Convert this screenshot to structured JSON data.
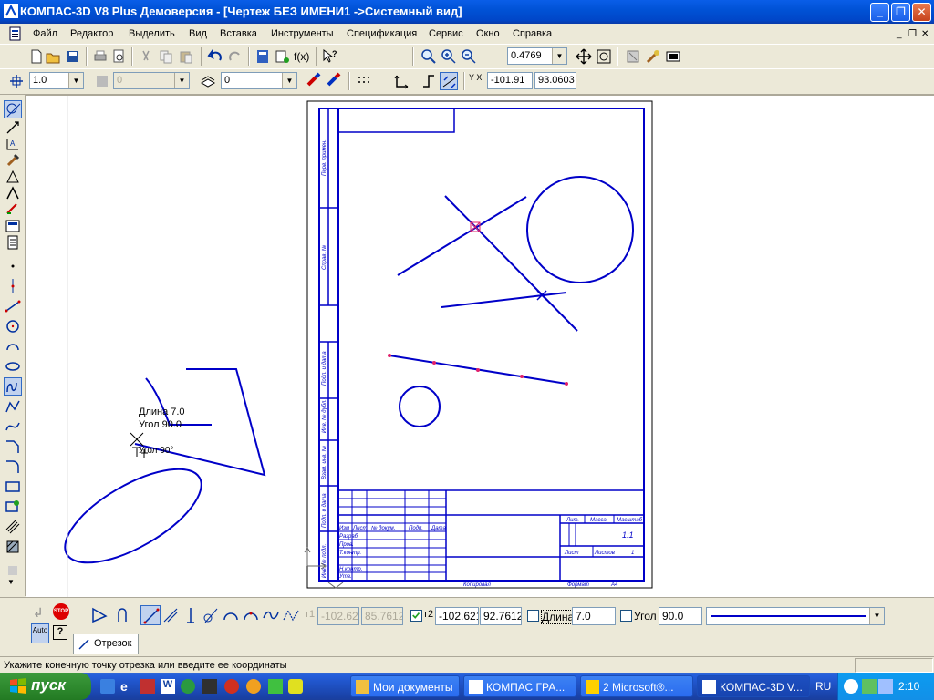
{
  "window": {
    "title": "КОМПАС-3D V8 Plus Демоверсия - [Чертеж БЕЗ ИМЕНИ1 ->Системный вид]",
    "minimize": "_",
    "maximize": "❐",
    "close": "✕"
  },
  "menu": {
    "items": [
      "Файл",
      "Редактор",
      "Выделить",
      "Вид",
      "Вставка",
      "Инструменты",
      "Спецификация",
      "Сервис",
      "Окно",
      "Справка"
    ],
    "mdi_controls": [
      "_",
      "❐",
      "✕"
    ]
  },
  "toolbar1": {
    "zoom_value": "0.4769",
    "formula_label": "f(x)"
  },
  "toolbar2": {
    "step_value": "1.0",
    "style_value": "0",
    "layer_value": "0",
    "coord_label": "Y X",
    "coord_x": "-101.91",
    "coord_y": "93.0603"
  },
  "canvas": {
    "hint_length": "Длина 7.0",
    "hint_angle": "Угол 90.0",
    "hint_angle2": "Угол 90°",
    "stamp": {
      "side_labels": [
        "Перв. примен.",
        "Справ. №",
        "Подп. и дата",
        "Инв. № дубл.",
        "Взам. инв. №",
        "Подп. и дата",
        "Инв. № подл."
      ],
      "left_headers": [
        "Изм",
        "Лист",
        "№ докум.",
        "Подп.",
        "Дата"
      ],
      "roles": [
        "Разраб.",
        "Пров.",
        "Т.контр.",
        "Н.контр.",
        "Утв."
      ],
      "lit": "Лит.",
      "mass": "Масса",
      "scale": "Масштаб",
      "scale_value": "1:1",
      "sheet": "Лист",
      "sheets": "Листов",
      "sheets_value": "1",
      "copied": "Копировал",
      "format": "Формат",
      "format_value": "A4"
    }
  },
  "panel": {
    "t1_label": "т1",
    "t1_x": "-102.621",
    "t1_y": "85.7612",
    "t2_label": "т2",
    "t2_x": "-102.621",
    "t2_y": "92.7612",
    "length_label": "Длина",
    "length_value": "7.0",
    "angle_label": "Угол",
    "angle_value": "90.0",
    "auto_label": "Auto",
    "tab_label": "Отрезок"
  },
  "status": {
    "message": "Укажите конечную точку отрезка или введите ее координаты"
  },
  "taskbar": {
    "start_label": "пуск",
    "tasks": [
      "Мои документы",
      "КОМПАС ГРА...",
      "2 Microsoft®...",
      "КОМПАС-3D V..."
    ],
    "lang": "RU",
    "clock": "2:10"
  },
  "colors": {
    "drawing_blue": "#0000c8",
    "point_magenta": "#e0206a",
    "titlebar_blue": "#0052d6"
  }
}
